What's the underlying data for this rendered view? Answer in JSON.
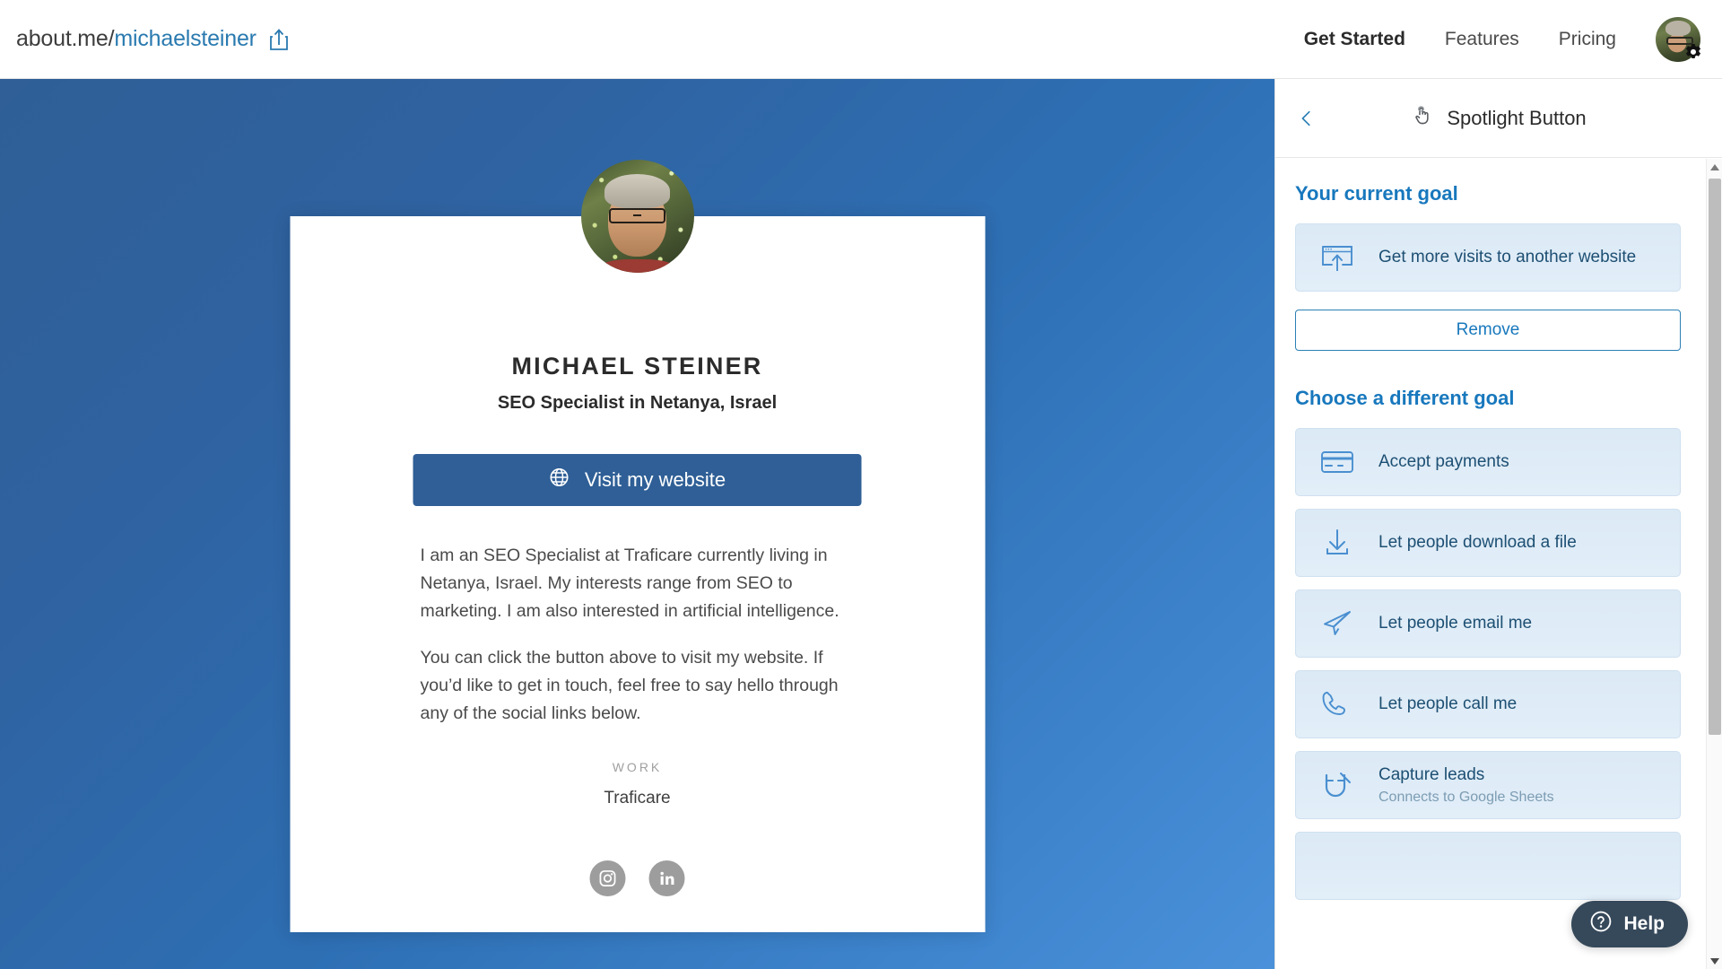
{
  "topnav": {
    "url_prefix": "about.me/",
    "url_handle": "michaelsteiner",
    "share_icon": "share-upload-icon",
    "links": [
      {
        "label": "Get Started",
        "active": true
      },
      {
        "label": "Features",
        "active": false
      },
      {
        "label": "Pricing",
        "active": false
      }
    ],
    "avatar_alt": "user-avatar",
    "settings_icon": "gear-icon"
  },
  "profile": {
    "name": "MICHAEL STEINER",
    "tagline": "SEO Specialist in Netanya, Israel",
    "cta": {
      "label": "Visit my website",
      "icon": "globe-icon"
    },
    "bio": [
      "I am an SEO Specialist at Traficare currently living in Netanya, Israel. My interests range from SEO to marketing. I am also interested in artificial intelligence.",
      "You can click the button above to visit my website. If you’d like to get in touch, feel free to say hello through any of the social links below."
    ],
    "work_label": "WORK",
    "work_value": "Traficare",
    "socials": [
      {
        "name": "instagram-icon"
      },
      {
        "name": "linkedin-icon"
      }
    ]
  },
  "sidebar": {
    "back_icon": "chevron-left-icon",
    "title": "Spotlight Button",
    "title_icon": "click-hand-icon",
    "current_goal_heading": "Your current goal",
    "current_goal": {
      "label": "Get more visits to another website",
      "icon": "browser-upload-icon"
    },
    "remove_label": "Remove",
    "choose_heading": "Choose a different goal",
    "goals": [
      {
        "label": "Accept payments",
        "sub": "",
        "icon": "credit-card-icon"
      },
      {
        "label": "Let people download a file",
        "sub": "",
        "icon": "download-arrow-icon"
      },
      {
        "label": "Let people email me",
        "sub": "",
        "icon": "paper-plane-icon"
      },
      {
        "label": "Let people call me",
        "sub": "",
        "icon": "phone-icon"
      },
      {
        "label": "Capture leads",
        "sub": "Connects to Google Sheets",
        "icon": "magnet-icon"
      }
    ]
  },
  "help": {
    "label": "Help",
    "icon": "question-circle-icon"
  },
  "colors": {
    "accent_blue": "#1878bd",
    "card_blue": "#2f5f96",
    "goal_card_bg": "#dceaf6",
    "help_bg": "#36495b",
    "link_blue": "#2a7ab0"
  }
}
